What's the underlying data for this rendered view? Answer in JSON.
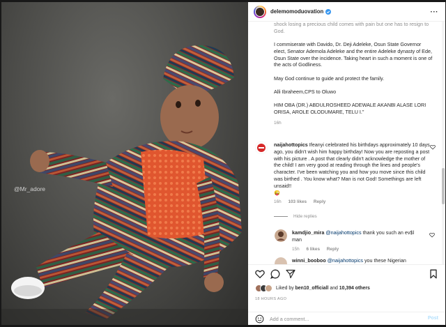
{
  "post": {
    "watermark": "@Mr_adore",
    "author": "delemomoduovation",
    "caption": {
      "top_fragment": "shock losing a precious child comes with pain but one has to resign to God.",
      "p1": "I commiserate with Davido, Dr. Deji Adeleke, Osun State Governor elect, Senator Ademola Adeleke and the entire Adeleke dynasty of Ede, Osun State over the incidence. Taking heart in such a moment is one of the acts of Godliness.",
      "p2": "May God continue to guide and protect the family.",
      "p3": "Alli Ibraheem,CPS to Oluwo",
      "p4": "HIM OBA (DR.) ABDULROSHEED ADEWALE AKANBI ALASE LORI ORISA, AROLE OLODUMARE, TELU I.\"",
      "time": "16h"
    },
    "comments": [
      {
        "user": "naijahottopics",
        "text": "Ifeanyi celebrated his birthdays approximately 10 days ago, you didn't wish him happy birthday! Now you are reposting a post with his picture . A post that clearly didn't acknowledge the mother of the child! I am very good at reading through the lines and people's character. I've been watching you and how you move since this child was birthed . You know what? Man is not God! Somethings are left unsaid!!",
        "emoji": "😜",
        "time": "16h",
        "likes": "103 likes",
        "reply": "Reply",
        "hide_replies": "Hide replies"
      }
    ],
    "replies": [
      {
        "user": "kamdjio_mira",
        "mention": "@naijahottopics",
        "text": " thank you such an ev$l man",
        "time": "15h",
        "likes": "6 likes",
        "reply": "Reply"
      },
      {
        "user": "winni_booboo",
        "mention": "@naijahottopics",
        "text": " you these Nigerian"
      }
    ],
    "liked_by_prefix": "Liked by ",
    "liked_by_user": "ben10_officiall",
    "liked_by_and": " and ",
    "liked_by_count": "10,394 others",
    "timestamp": "18 HOURS AGO",
    "comment_placeholder": "Add a comment...",
    "post_button": "Post"
  },
  "colors": {
    "link": "#00376b",
    "muted": "#8e8e8e",
    "post_disabled": "#b2dffc",
    "verified": "#3897f0"
  },
  "icons": [
    "verified-icon",
    "more-icon",
    "heart-icon",
    "comment-icon",
    "share-icon",
    "bookmark-icon",
    "emoji-icon"
  ]
}
